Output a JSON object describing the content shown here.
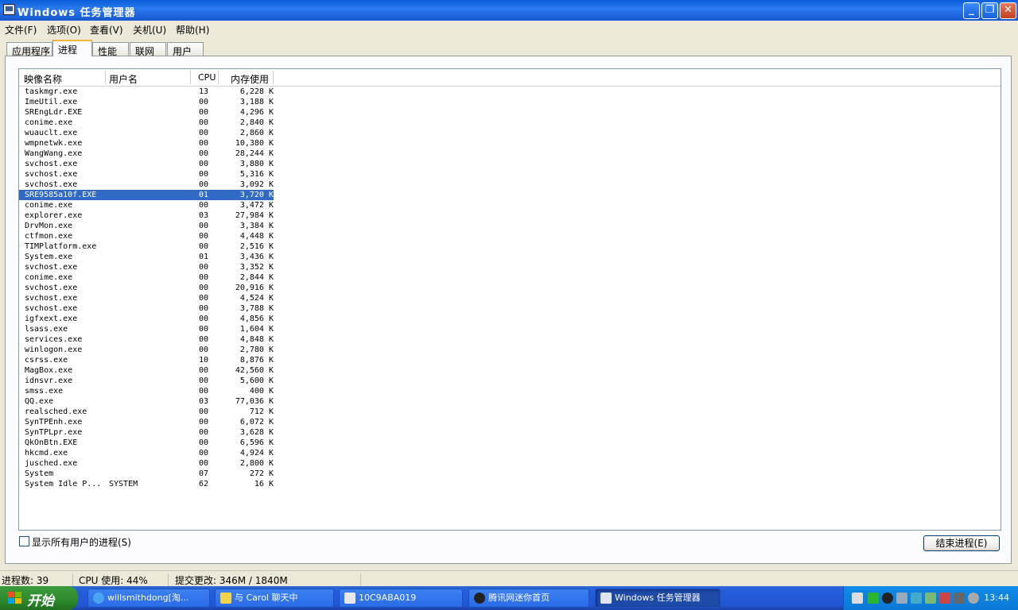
{
  "window": {
    "title": "Windows 任务管理器",
    "min": "_",
    "max": "❐",
    "close": "✕"
  },
  "menu": [
    "文件(F)",
    "选项(O)",
    "查看(V)",
    "关机(U)",
    "帮助(H)"
  ],
  "tabs": [
    "应用程序",
    "进程",
    "性能",
    "联网",
    "用户"
  ],
  "table": {
    "headers": {
      "name": "映像名称",
      "user": "用户名",
      "cpu": "CPU",
      "mem": "内存使用"
    },
    "rows": [
      {
        "name": "taskmgr.exe",
        "user": "",
        "cpu": "13",
        "mem": "6,228 K"
      },
      {
        "name": "ImeUtil.exe",
        "user": "",
        "cpu": "00",
        "mem": "3,188 K"
      },
      {
        "name": "SREngLdr.EXE",
        "user": "",
        "cpu": "00",
        "mem": "4,296 K"
      },
      {
        "name": "conime.exe",
        "user": "",
        "cpu": "00",
        "mem": "2,840 K"
      },
      {
        "name": "wuauclt.exe",
        "user": "",
        "cpu": "00",
        "mem": "2,860 K"
      },
      {
        "name": "wmpnetwk.exe",
        "user": "",
        "cpu": "00",
        "mem": "10,380 K"
      },
      {
        "name": "WangWang.exe",
        "user": "",
        "cpu": "00",
        "mem": "28,244 K"
      },
      {
        "name": "svchost.exe",
        "user": "",
        "cpu": "00",
        "mem": "3,880 K"
      },
      {
        "name": "svchost.exe",
        "user": "",
        "cpu": "00",
        "mem": "5,316 K"
      },
      {
        "name": "svchost.exe",
        "user": "",
        "cpu": "00",
        "mem": "3,092 K"
      },
      {
        "name": "SRE9585a10f.EXE",
        "user": "",
        "cpu": "01",
        "mem": "3,720 K"
      },
      {
        "name": "conime.exe",
        "user": "",
        "cpu": "00",
        "mem": "3,472 K"
      },
      {
        "name": "explorer.exe",
        "user": "",
        "cpu": "03",
        "mem": "27,984 K"
      },
      {
        "name": "DrvMon.exe",
        "user": "",
        "cpu": "00",
        "mem": "3,384 K"
      },
      {
        "name": "ctfmon.exe",
        "user": "",
        "cpu": "00",
        "mem": "4,448 K"
      },
      {
        "name": "TIMPlatform.exe",
        "user": "",
        "cpu": "00",
        "mem": "2,516 K"
      },
      {
        "name": "System.exe",
        "user": "",
        "cpu": "01",
        "mem": "3,436 K"
      },
      {
        "name": "svchost.exe",
        "user": "",
        "cpu": "00",
        "mem": "3,352 K"
      },
      {
        "name": "conime.exe",
        "user": "",
        "cpu": "00",
        "mem": "2,844 K"
      },
      {
        "name": "svchost.exe",
        "user": "",
        "cpu": "00",
        "mem": "20,916 K"
      },
      {
        "name": "svchost.exe",
        "user": "",
        "cpu": "00",
        "mem": "4,524 K"
      },
      {
        "name": "svchost.exe",
        "user": "",
        "cpu": "00",
        "mem": "3,788 K"
      },
      {
        "name": "igfxext.exe",
        "user": "",
        "cpu": "00",
        "mem": "4,856 K"
      },
      {
        "name": "lsass.exe",
        "user": "",
        "cpu": "00",
        "mem": "1,604 K"
      },
      {
        "name": "services.exe",
        "user": "",
        "cpu": "00",
        "mem": "4,848 K"
      },
      {
        "name": "winlogon.exe",
        "user": "",
        "cpu": "00",
        "mem": "2,780 K"
      },
      {
        "name": "csrss.exe",
        "user": "",
        "cpu": "10",
        "mem": "8,876 K"
      },
      {
        "name": "MagBox.exe",
        "user": "",
        "cpu": "00",
        "mem": "42,560 K"
      },
      {
        "name": "idnsvr.exe",
        "user": "",
        "cpu": "00",
        "mem": "5,600 K"
      },
      {
        "name": "smss.exe",
        "user": "",
        "cpu": "00",
        "mem": "400 K"
      },
      {
        "name": "QQ.exe",
        "user": "",
        "cpu": "03",
        "mem": "77,036 K"
      },
      {
        "name": "realsched.exe",
        "user": "",
        "cpu": "00",
        "mem": "712 K"
      },
      {
        "name": "SynTPEnh.exe",
        "user": "",
        "cpu": "00",
        "mem": "6,072 K"
      },
      {
        "name": "SynTPLpr.exe",
        "user": "",
        "cpu": "00",
        "mem": "3,628 K"
      },
      {
        "name": "QkOnBtn.EXE",
        "user": "",
        "cpu": "00",
        "mem": "6,596 K"
      },
      {
        "name": "hkcmd.exe",
        "user": "",
        "cpu": "00",
        "mem": "4,924 K"
      },
      {
        "name": "jusched.exe",
        "user": "",
        "cpu": "00",
        "mem": "2,800 K"
      },
      {
        "name": "System",
        "user": "",
        "cpu": "07",
        "mem": "272 K"
      },
      {
        "name": "System Idle P...",
        "user": "SYSTEM",
        "cpu": "62",
        "mem": "16 K"
      }
    ],
    "selected_row": "SRE9585a10f.EXE"
  },
  "show_all_label": "显示所有用户的进程(S)",
  "end_button": "结束进程(E)",
  "status": {
    "processes": "进程数: 39",
    "cpu": "CPU 使用: 44%",
    "commit": "提交更改: 346M / 1840M"
  },
  "taskbar": {
    "start": "开始",
    "tasks": [
      "willsmithdong[淘...",
      "与  Carol 聊天中",
      "10C9ABA019",
      "腾讯网迷你首页",
      "Windows 任务管理器"
    ],
    "clock": "13:44"
  },
  "colors": {
    "titlebar": "#0a5fd8",
    "selection": "#316ac5",
    "taskbar": "#245edc",
    "start": "#2d8a2d",
    "tray": "#0f8be8"
  }
}
